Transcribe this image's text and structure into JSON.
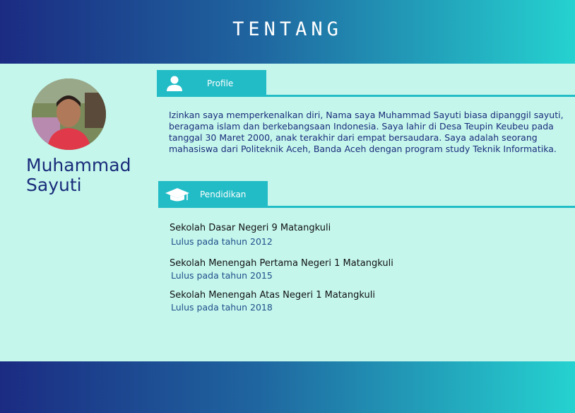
{
  "header": {
    "title": "TENTANG"
  },
  "profile": {
    "name_line1": "Muhammad",
    "name_line2": "Sayuti"
  },
  "sections": {
    "profile": {
      "tab_label": "Profile",
      "icon": "user-icon",
      "bio": "Izinkan saya memperkenalkan diri, Nama saya Muhammad Sayuti biasa dipanggil sayuti, beragama islam dan berkebangsaan Indonesia. Saya lahir di Desa Teupin Keubeu pada tanggal 30 Maret 2000, anak terakhir dari empat bersaudara. Saya adalah seorang mahasiswa dari Politeknik Aceh, Banda Aceh dengan program study Teknik Informatika."
    },
    "pendidikan": {
      "tab_label": "Pendidikan",
      "icon": "graduation-cap-icon",
      "items": [
        {
          "school": "Sekolah Dasar Negeri 9 Matangkuli",
          "year": "Lulus pada tahun 2012"
        },
        {
          "school": "Sekolah Menengah Pertama Negeri 1 Matangkuli",
          "year": "Lulus pada tahun 2015"
        },
        {
          "school": "Sekolah Menengah Atas Negeri 1 Matangkuli",
          "year": "Lulus pada tahun 2018"
        }
      ]
    }
  },
  "colors": {
    "background": "#c4f6ec",
    "accent": "#22bcc6",
    "gradient_start": "#1b2b82",
    "gradient_end": "#25d2d0",
    "text_blue": "#1a2c7a"
  }
}
